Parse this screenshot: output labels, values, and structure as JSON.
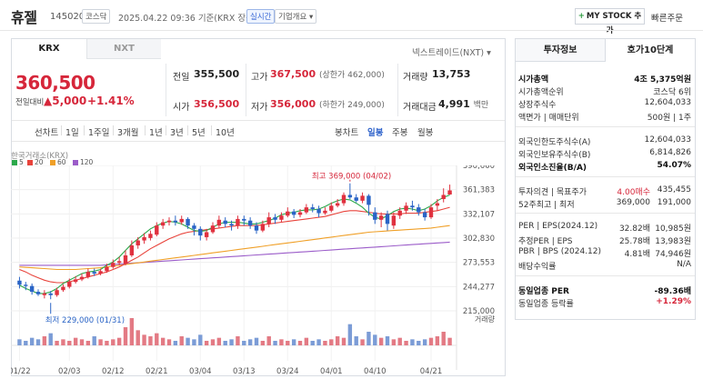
{
  "header": {
    "name": "휴젤",
    "code": "145020",
    "market_badge": "코스닥",
    "datetime": "2025.04.22 09:36",
    "basis": "기준(KRX 장중)",
    "live_badge": "실시간",
    "company_info": "기업개요",
    "mystock_button": "MY STOCK 추가",
    "quick_order": "빠른주문"
  },
  "tabs": {
    "krx": "KRX",
    "nxt": "NXT",
    "nextrade": "넥스트레이드(NXT)"
  },
  "quote": {
    "price": "360,500",
    "change_label": "전일대비",
    "change_value": "▲5,000",
    "change_pct": "+1.41%",
    "prev_close_label": "전일",
    "prev_close": "355,500",
    "high_label": "고가",
    "high": "367,500",
    "upper_limit": "(상한가 462,000)",
    "volume_label": "거래량",
    "volume": "13,753",
    "open_label": "시가",
    "open": "356,500",
    "low_label": "저가",
    "low": "356,000",
    "lower_limit": "(하한가 249,000)",
    "turnover_label": "거래대금",
    "turnover": "4,991",
    "turnover_unit": "백만"
  },
  "periods": {
    "types": [
      "선차트",
      "1일",
      "1주일",
      "3개월",
      "1년",
      "3년",
      "5년",
      "10년"
    ],
    "candle_types": [
      "봉차트",
      "일봉",
      "주봉",
      "월봉"
    ],
    "selected": "일봉"
  },
  "chart_title": "한국거래소(KRX)",
  "legend": [
    {
      "label": "5",
      "color": "#2aa84a"
    },
    {
      "label": "20",
      "color": "#e8433b"
    },
    {
      "label": "60",
      "color": "#f0a028"
    },
    {
      "label": "120",
      "color": "#9b5cc9"
    }
  ],
  "chart_data": {
    "type": "candlestick",
    "y_ticks": [
      "390,660",
      "361,383",
      "332,107",
      "302,830",
      "273,553",
      "244,277",
      "215,000"
    ],
    "ylim": [
      215000,
      390660
    ],
    "x_ticks": [
      "01/22",
      "02/03",
      "02/12",
      "02/21",
      "03/04",
      "03/13",
      "03/24",
      "04/01",
      "04/10",
      "04/21"
    ],
    "volume_label": "거래량",
    "annotations": {
      "max": "최고 369,000 (04/02)",
      "min": "최저 229,000 (01/31)"
    },
    "candles": [
      [
        251500,
        246500,
        256000,
        242000
      ],
      [
        246500,
        245000,
        250000,
        240000
      ],
      [
        245000,
        238000,
        248000,
        234500
      ],
      [
        238000,
        235000,
        241000,
        233000
      ],
      [
        234000,
        236000,
        240000,
        230000
      ],
      [
        236000,
        234000,
        239000,
        229000
      ],
      [
        234000,
        240000,
        243000,
        232000
      ],
      [
        240000,
        244000,
        247000,
        238000
      ],
      [
        244000,
        250000,
        254000,
        242000
      ],
      [
        250000,
        253000,
        257000,
        248000
      ],
      [
        253000,
        256000,
        260000,
        251000
      ],
      [
        256000,
        262000,
        266000,
        254000
      ],
      [
        262000,
        260000,
        266000,
        257000
      ],
      [
        260000,
        263000,
        266000,
        258000
      ],
      [
        263000,
        268000,
        272000,
        261000
      ],
      [
        268000,
        273000,
        277000,
        266000
      ],
      [
        273000,
        275000,
        280000,
        270000
      ],
      [
        272000,
        282000,
        288000,
        270000
      ],
      [
        282000,
        294000,
        300000,
        280000
      ],
      [
        294000,
        300000,
        304000,
        290000
      ],
      [
        300000,
        304000,
        309000,
        296000
      ],
      [
        303000,
        308000,
        312000,
        300000
      ],
      [
        307000,
        318000,
        322000,
        305000
      ],
      [
        318000,
        322000,
        326000,
        314000
      ],
      [
        322000,
        324000,
        328000,
        318000
      ],
      [
        324000,
        322000,
        330000,
        318000
      ],
      [
        322000,
        326000,
        330000,
        319000
      ],
      [
        326000,
        318000,
        328000,
        314000
      ],
      [
        318000,
        314000,
        321000,
        306000
      ],
      [
        314000,
        306000,
        317000,
        300000
      ],
      [
        304000,
        310000,
        314000,
        300000
      ],
      [
        310000,
        318000,
        322000,
        308000
      ],
      [
        318000,
        325000,
        330000,
        315000
      ],
      [
        324000,
        320000,
        328000,
        316000
      ],
      [
        320000,
        318000,
        324000,
        312000
      ],
      [
        318000,
        326000,
        330000,
        314000
      ],
      [
        326000,
        324000,
        330000,
        318000
      ],
      [
        324000,
        318000,
        328000,
        314000
      ],
      [
        318000,
        312000,
        322000,
        308000
      ],
      [
        312000,
        320000,
        324000,
        310000
      ],
      [
        320000,
        328000,
        334000,
        316000
      ],
      [
        328000,
        325000,
        332000,
        320000
      ],
      [
        325000,
        330000,
        334000,
        322000
      ],
      [
        330000,
        335000,
        340000,
        328000
      ],
      [
        335000,
        331000,
        338000,
        327000
      ],
      [
        331000,
        334000,
        338000,
        328000
      ],
      [
        334000,
        340000,
        344000,
        332000
      ],
      [
        340000,
        338000,
        344000,
        334000
      ],
      [
        338000,
        333000,
        342000,
        328000
      ],
      [
        333000,
        336000,
        340000,
        331000
      ],
      [
        336000,
        342000,
        346000,
        334000
      ],
      [
        342000,
        345000,
        350000,
        340000
      ],
      [
        345000,
        355000,
        358000,
        342000
      ],
      [
        355000,
        352000,
        369000,
        350000
      ],
      [
        352000,
        348000,
        356000,
        346000
      ],
      [
        348000,
        354000,
        358000,
        345000
      ],
      [
        354000,
        343000,
        356000,
        330000
      ],
      [
        334000,
        325000,
        340000,
        320000
      ],
      [
        325000,
        330000,
        334000,
        316000
      ],
      [
        332000,
        320000,
        336000,
        312000
      ],
      [
        318000,
        330000,
        334000,
        314000
      ],
      [
        330000,
        336000,
        340000,
        326000
      ],
      [
        336000,
        342000,
        346000,
        332000
      ],
      [
        342000,
        340000,
        348000,
        336000
      ],
      [
        340000,
        334000,
        344000,
        330000
      ],
      [
        334000,
        328000,
        338000,
        324000
      ],
      [
        328000,
        340000,
        344000,
        326000
      ],
      [
        342000,
        345000,
        350000,
        336000
      ],
      [
        350000,
        355000,
        363000,
        346000
      ],
      [
        355500,
        360500,
        367500,
        356000
      ]
    ],
    "ma5": [
      246000,
      242000,
      239000,
      236000,
      236000,
      238000,
      242000,
      248000,
      252000,
      256000,
      260000,
      262000,
      263000,
      265000,
      270000,
      274000,
      280000,
      288000,
      296000,
      302000,
      308000,
      314000,
      318000,
      321000,
      323000,
      322000,
      320000,
      316000,
      312000,
      311000,
      312000,
      316000,
      320000,
      322000,
      322000,
      322000,
      321000,
      320000,
      320000,
      322000,
      324000,
      327000,
      331000,
      333000,
      334000,
      336000,
      337000,
      337000,
      338000,
      341000,
      345000,
      348000,
      350000,
      349000,
      345000,
      340000,
      333000,
      328000,
      326000,
      330000,
      335000,
      338000,
      339000,
      338000,
      336000,
      338000,
      342000,
      348000,
      352000,
      355000
    ],
    "ma20": [
      265000,
      262000,
      258000,
      255000,
      252000,
      250000,
      249000,
      249000,
      250000,
      252000,
      254000,
      256000,
      258000,
      260000,
      262000,
      265000,
      268000,
      272000,
      276000,
      280000,
      285000,
      290000,
      294000,
      298000,
      302000,
      305000,
      308000,
      310000,
      311000,
      312000,
      313000,
      314000,
      315000,
      316000,
      317000,
      318000,
      318000,
      318000,
      318000,
      319000,
      320000,
      321000,
      322000,
      323000,
      324000,
      325000,
      326000,
      327000,
      328000,
      329000,
      331000,
      333000,
      335000,
      336000,
      336000,
      335000,
      334000,
      333000,
      332000,
      332000,
      332000,
      332000,
      333000,
      333000,
      333000,
      334000,
      335000,
      336000,
      338000,
      340000
    ],
    "ma60": [
      268000,
      267500,
      267000,
      266500,
      266000,
      265500,
      265000,
      265000,
      265000,
      265000,
      265500,
      266000,
      266500,
      267000,
      268000,
      269000,
      270000,
      271000,
      272000,
      273000,
      274000,
      275000,
      276000,
      277000,
      278000,
      279000,
      280000,
      281000,
      282000,
      283000,
      284000,
      285000,
      286000,
      287000,
      288000,
      289000,
      290000,
      291000,
      292000,
      293000,
      294000,
      295000,
      296000,
      297000,
      298000,
      299000,
      300000,
      301000,
      302000,
      303000,
      304000,
      305000,
      306000,
      307000,
      308000,
      309000,
      310000,
      310500,
      311000,
      311500,
      312000,
      312500,
      313000,
      313500,
      314000,
      314500,
      315000,
      316000,
      317000,
      318000
    ],
    "ma120": [
      270000,
      270000,
      270000,
      270000,
      270000,
      270000,
      270000,
      270000,
      270000,
      270000,
      270000,
      270000,
      270000,
      270000,
      270500,
      271000,
      271500,
      272000,
      272500,
      273000,
      273500,
      274000,
      274500,
      275000,
      275500,
      276000,
      276500,
      277000,
      277500,
      278000,
      278500,
      279000,
      279500,
      280000,
      280500,
      281000,
      281500,
      282000,
      282500,
      283000,
      283500,
      284000,
      284500,
      285000,
      285500,
      286000,
      286500,
      287000,
      287500,
      288000,
      288500,
      289000,
      289500,
      290000,
      290500,
      291000,
      291500,
      292000,
      292500,
      293000,
      293500,
      294000,
      294500,
      295000,
      295500,
      296000,
      296500,
      297000,
      297500,
      298000
    ],
    "volumes": [
      4,
      3,
      5,
      4,
      6,
      8,
      3,
      4,
      3,
      5,
      4,
      3,
      6,
      4,
      3,
      4,
      5,
      12,
      18,
      10,
      7,
      6,
      8,
      5,
      4,
      3,
      6,
      5,
      4,
      7,
      3,
      4,
      5,
      3,
      4,
      6,
      3,
      4,
      5,
      3,
      6,
      3,
      4,
      3,
      4,
      3,
      5,
      3,
      4,
      3,
      4,
      6,
      5,
      14,
      6,
      4,
      9,
      7,
      5,
      6,
      4,
      5,
      3,
      4,
      3,
      4,
      5,
      6,
      9,
      5
    ]
  },
  "invest_info": {
    "tab1": "투자정보",
    "tab2": "호가10단계",
    "rows": [
      {
        "k": "시가총액",
        "v": "4조 5,375억원",
        "bold": true
      },
      {
        "k": "시가총액순위",
        "v": "코스닥 6위"
      },
      {
        "k": "상장주식수",
        "v": "12,604,033"
      },
      {
        "k": "액면가 | 매매단위",
        "v": "500원 | 1주"
      },
      {
        "k": "외국인한도주식수(A)",
        "v": "12,604,033"
      },
      {
        "k": "외국인보유주식수(B)",
        "v": "6,814,826"
      },
      {
        "k": "외국인소진율(B/A)",
        "v": "54.07%",
        "bold": true
      },
      {
        "k": "투자의견 | 목표주가",
        "m": "4.00매수",
        "v": "435,455"
      },
      {
        "k": "52주최고 | 최저",
        "m": "369,000",
        "v": "191,000"
      },
      {
        "k": "PER | EPS(2024.12)",
        "m": "32.82배",
        "v": "10,985원"
      },
      {
        "k": "추정PER | EPS",
        "m": "25.78배",
        "v": "13,983원"
      },
      {
        "k": "PBR | BPS (2024.12)",
        "m": "4.81배",
        "v": "74,946원"
      },
      {
        "k": "배당수익률",
        "v": "N/A"
      },
      {
        "k": "동일업종 PER",
        "v": "-89.36배",
        "bold": true
      },
      {
        "k": "동일업종 등락률",
        "v": "+1.29%",
        "red": true
      }
    ]
  }
}
